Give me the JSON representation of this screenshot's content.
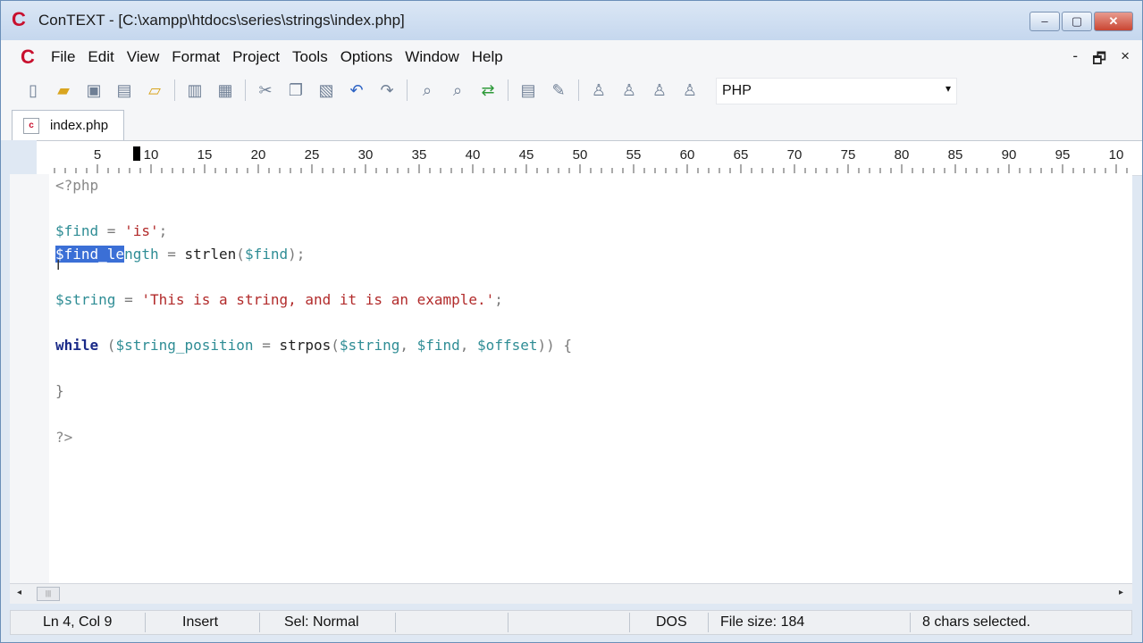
{
  "window": {
    "title": "ConTEXT - [C:\\xampp\\htdocs\\series\\strings\\index.php]",
    "app_icon": "C",
    "controls": {
      "minimize": "‒",
      "maximize": "▢",
      "close": "✕"
    }
  },
  "menubar": {
    "items": [
      "File",
      "Edit",
      "View",
      "Format",
      "Project",
      "Tools",
      "Options",
      "Window",
      "Help"
    ],
    "mdi_controls": [
      "-",
      "🗗",
      "×"
    ]
  },
  "toolbar": {
    "icons": [
      "new-file-icon",
      "open-folder-icon",
      "save-icon",
      "save-all-icon",
      "open-project-icon",
      "print-icon",
      "print-preview-icon",
      "cut-icon",
      "copy-icon",
      "paste-icon",
      "undo-icon",
      "redo-icon",
      "find-icon",
      "find-next-icon",
      "replace-icon",
      "document-icon",
      "tools-icon",
      "user-1-icon",
      "user-2-icon",
      "user-3-icon",
      "user-4-icon"
    ],
    "language_select": {
      "value": "PHP",
      "arrow": "▾"
    }
  },
  "tabs": [
    {
      "label": "index.php",
      "icon": "c"
    }
  ],
  "ruler": {
    "labels": [
      "5",
      "10",
      "15",
      "20",
      "25",
      "30",
      "35",
      "40",
      "45",
      "50",
      "55",
      "60",
      "65",
      "70",
      "75",
      "80",
      "85",
      "90",
      "95",
      "10"
    ]
  },
  "editor": {
    "lines": [
      [
        {
          "t": "<?php",
          "c": "php"
        }
      ],
      [],
      [
        {
          "t": "$find",
          "c": "var"
        },
        {
          "t": " = ",
          "c": "op"
        },
        {
          "t": "'is'",
          "c": "str"
        },
        {
          "t": ";",
          "c": "op"
        }
      ],
      [
        {
          "t": "$find_le",
          "c": "var sel"
        },
        {
          "t": "ngth",
          "c": "var"
        },
        {
          "t": " = ",
          "c": "op"
        },
        {
          "t": "strlen",
          "c": "fn"
        },
        {
          "t": "(",
          "c": "op"
        },
        {
          "t": "$find",
          "c": "var"
        },
        {
          "t": ");",
          "c": "op"
        }
      ],
      [],
      [
        {
          "t": "$string",
          "c": "var"
        },
        {
          "t": " = ",
          "c": "op"
        },
        {
          "t": "'This is a string, and it is an example.'",
          "c": "str"
        },
        {
          "t": ";",
          "c": "op"
        }
      ],
      [],
      [
        {
          "t": "while",
          "c": "kw"
        },
        {
          "t": " (",
          "c": "op"
        },
        {
          "t": "$string_position",
          "c": "var"
        },
        {
          "t": " = ",
          "c": "op"
        },
        {
          "t": "strpos",
          "c": "fn"
        },
        {
          "t": "(",
          "c": "op"
        },
        {
          "t": "$string",
          "c": "var"
        },
        {
          "t": ", ",
          "c": "op"
        },
        {
          "t": "$find",
          "c": "var"
        },
        {
          "t": ", ",
          "c": "op"
        },
        {
          "t": "$offset",
          "c": "var"
        },
        {
          "t": ")) {",
          "c": "op"
        }
      ],
      [],
      [
        {
          "t": "}",
          "c": "op"
        }
      ],
      [],
      [
        {
          "t": "?>",
          "c": "php"
        }
      ]
    ],
    "mouse_cursor": "I"
  },
  "hscroll": {
    "left": "◂",
    "thumb": "|||",
    "right": "▸"
  },
  "statusbar": {
    "position": "Ln 4, Col 9",
    "mode": "Insert",
    "selection_mode": "Sel: Normal",
    "line_endings": "DOS",
    "file_size": "File size: 184",
    "selected": "8 chars selected."
  }
}
